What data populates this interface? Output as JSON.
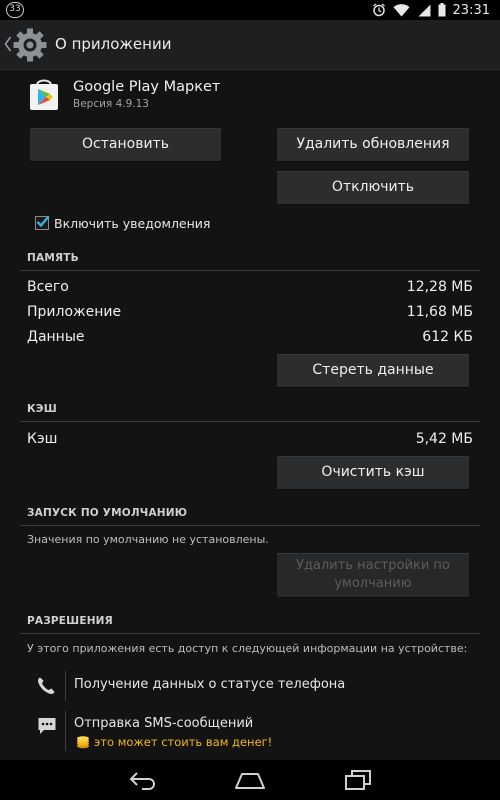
{
  "status_bar": {
    "notification_count": "33",
    "time": "23:31",
    "icons": [
      "alarm-icon",
      "wifi-icon",
      "signal-icon",
      "battery-icon"
    ]
  },
  "action_bar": {
    "title": "О приложении",
    "icon": "settings-gear-icon"
  },
  "app": {
    "name": "Google Play Маркет",
    "version": "Версия 4.9.13"
  },
  "buttons": {
    "force_stop": "Остановить",
    "uninstall_updates": "Удалить обновления",
    "disable": "Отключить",
    "clear_data": "Стереть данные",
    "clear_cache": "Очистить кэш",
    "clear_defaults": "Удалить настройки по умолчанию"
  },
  "notifications": {
    "label": "Включить уведомления",
    "checked": true
  },
  "storage": {
    "header": "ПАМЯТЬ",
    "rows": [
      {
        "label": "Всего",
        "value": "12,28 МБ"
      },
      {
        "label": "Приложение",
        "value": "11,68 МБ"
      },
      {
        "label": "Данные",
        "value": "612 КБ"
      }
    ]
  },
  "cache": {
    "header": "КЭШ",
    "label": "Кэш",
    "value": "5,42 МБ"
  },
  "launch_defaults": {
    "header": "ЗАПУСК ПО УМОЛЧАНИЮ",
    "text": "Значения по умолчанию не установлены."
  },
  "permissions": {
    "header": "РАЗРЕШЕНИЯ",
    "intro": "У этого приложения есть доступ к следующей информации на устройстве:",
    "items": [
      {
        "label": "Получение данных о статусе телефона",
        "icon": "phone-icon"
      },
      {
        "label": "Отправка SMS-сообщений",
        "icon": "sms-icon",
        "warning": "это может стоить вам денег!"
      }
    ]
  },
  "colors": {
    "accent": "#33b5e5",
    "warning": "#f1b715",
    "background": "#131313"
  }
}
